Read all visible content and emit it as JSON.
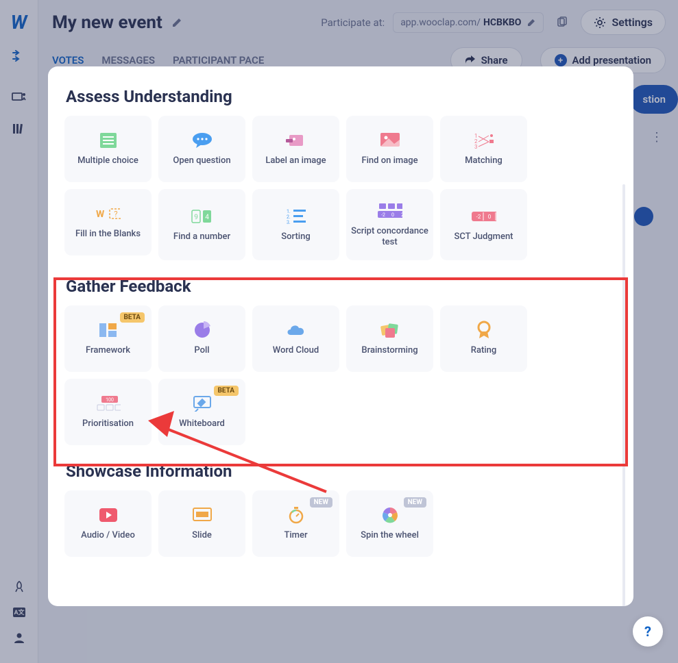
{
  "header": {
    "title": "My new event",
    "participate_label": "Participate at:",
    "url_prefix": "app.wooclap.com/",
    "url_code": "HCBKBO",
    "settings": "Settings",
    "tabs": {
      "votes": "VOTES",
      "messages": "MESSAGES",
      "pace": "PARTICIPANT PACE"
    },
    "share": "Share",
    "add_presentation": "Add presentation",
    "bg_button_slice": "stion"
  },
  "sections": {
    "assess": {
      "title": "Assess Understanding",
      "cards": [
        {
          "label": "Multiple choice"
        },
        {
          "label": "Open question"
        },
        {
          "label": "Label an image"
        },
        {
          "label": "Find on image"
        },
        {
          "label": "Matching"
        },
        {
          "label": "Fill in the Blanks"
        },
        {
          "label": "Find a number"
        },
        {
          "label": "Sorting"
        },
        {
          "label": "Script concordance test"
        },
        {
          "label": "SCT Judgment"
        }
      ]
    },
    "feedback": {
      "title": "Gather Feedback",
      "cards": [
        {
          "label": "Framework",
          "badge": "BETA"
        },
        {
          "label": "Poll"
        },
        {
          "label": "Word Cloud"
        },
        {
          "label": "Brainstorming"
        },
        {
          "label": "Rating"
        },
        {
          "label": "Prioritisation"
        },
        {
          "label": "Whiteboard",
          "badge": "BETA"
        }
      ]
    },
    "showcase": {
      "title": "Showcase Information",
      "cards": [
        {
          "label": "Audio / Video"
        },
        {
          "label": "Slide"
        },
        {
          "label": "Timer",
          "badge": "NEW"
        },
        {
          "label": "Spin the wheel",
          "badge": "NEW"
        }
      ]
    }
  },
  "help": "?"
}
